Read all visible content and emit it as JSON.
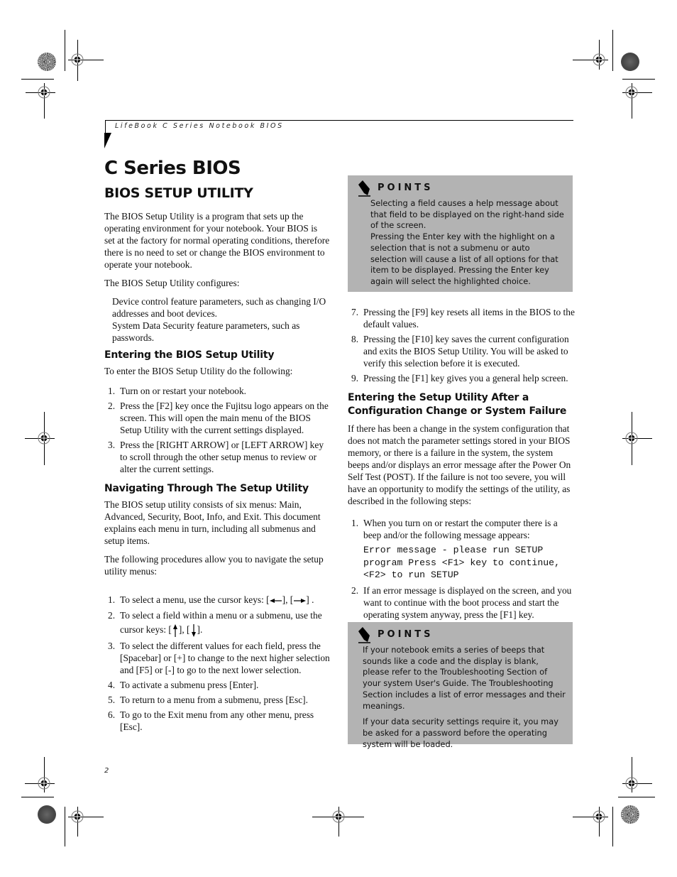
{
  "running_head": "LifeBook C Series Notebook BIOS",
  "title": "C Series BIOS",
  "section_title": "BIOS SETUP UTILITY",
  "intro": {
    "paragraph": "The BIOS Setup Utility is a program that sets up the operating environment for your notebook. Your BIOS is set at the factory for normal operating conditions, therefore there is no need to set or change the BIOS environment to operate your notebook.",
    "configures_lead": "The BIOS Setup Utility configures:",
    "configures_items": [
      "Device control feature parameters, such as changing I/O addresses and boot devices.",
      "System Data Security feature parameters, such as passwords."
    ]
  },
  "entering": {
    "heading": "Entering the BIOS Setup Utility",
    "lead": "To enter the BIOS Setup Utility do the following:",
    "steps": [
      {
        "num": "1.",
        "text": "Turn on or restart your notebook."
      },
      {
        "num": "2.",
        "text": "Press the [F2] key once the Fujitsu logo appears on the screen. This will open the main menu of the BIOS Setup Utility with the current settings displayed."
      },
      {
        "num": "3.",
        "text": "Press the [RIGHT ARROW] or [LEFT ARROW] key to scroll through the other setup menus to review or alter the current settings."
      }
    ]
  },
  "navigating": {
    "heading": "Navigating Through The Setup Utility",
    "paragraph1": "The BIOS setup utility consists of six menus: Main, Advanced, Security, Boot, Info, and Exit. This document explains each menu in turn, including all submenus and setup items.",
    "paragraph2": "The following procedures allow you to navigate the setup utility menus:",
    "steps": [
      {
        "num": "1.",
        "text_before": "To select a menu, use the cursor keys: [",
        "mid": "], [",
        "text_after": "] .",
        "icons": [
          "left-arrow-icon",
          "right-arrow-icon"
        ]
      },
      {
        "num": "2.",
        "text_before": "To select a field within a menu or a submenu, use the cursor keys: [",
        "mid": "], [",
        "text_after": "].",
        "icons": [
          "up-arrow-icon",
          "down-arrow-icon"
        ]
      },
      {
        "num": "3.",
        "text": "To select the different values for each field, press the [Spacebar] or [+] to change to the next higher selection and [F5] or [-] to go to the next lower selection."
      },
      {
        "num": "4.",
        "text": "To activate a submenu press [Enter]."
      },
      {
        "num": "5.",
        "text": "To return to a menu from a submenu, press [Esc]."
      },
      {
        "num": "6.",
        "text": "To go to the Exit menu from any other menu, press [Esc]."
      },
      {
        "num": "7.",
        "text": "Pressing the [F9] key resets all items in the BIOS to the default values."
      },
      {
        "num": "8.",
        "text": "Pressing the [F10] key saves the current configuration and exits the BIOS Setup Utility. You will be asked to verify this selection before it is executed."
      },
      {
        "num": "9.",
        "text": "Pressing the [F1] key gives you a general help screen."
      }
    ]
  },
  "points1": {
    "title": "POINTS",
    "icon": "pencil-icon",
    "para1": "Selecting a field causes a help message about that field to be displayed on the right-hand side of the screen.",
    "para2": "Pressing the Enter key with the highlight on a selection that is not a submenu or auto selection will cause a list of all options for that item to be displayed. Pressing the Enter key again will select the highlighted choice."
  },
  "failure": {
    "heading": "Entering the Setup Utility After a Configuration Change or System Failure",
    "paragraph": "If there has been a change in the system configuration that does not match the parameter settings stored in your BIOS memory, or there is a failure in the system, the system beeps and/or displays an error message after the Power On Self Test (POST). If the failure is not too severe, you will have an opportunity to modify the settings of the utility, as described in the following steps:",
    "steps": [
      {
        "num": "1.",
        "text": "When you turn on or restart the computer there is a beep and/or the following message appears:"
      },
      {
        "num": "2.",
        "text": "If an error message is displayed on the screen, and you want to continue with the boot process and start the operating system anyway, press the [F1] key."
      }
    ],
    "error_message": "Error message - please run SETUP\nprogram Press <F1> key to continue,\n<F2> to run SETUP"
  },
  "points2": {
    "title": "POINTS",
    "icon": "pencil-icon",
    "para1": "If your notebook emits a series of beeps that sounds like a code and the display is blank, please refer to the Troubleshooting Section of your system User's Guide. The Troubleshooting Section includes a list of error messages and their meanings.",
    "para2": "If your data security settings require it, you may be asked for a password before the operating system will be loaded."
  },
  "page_number": "2"
}
